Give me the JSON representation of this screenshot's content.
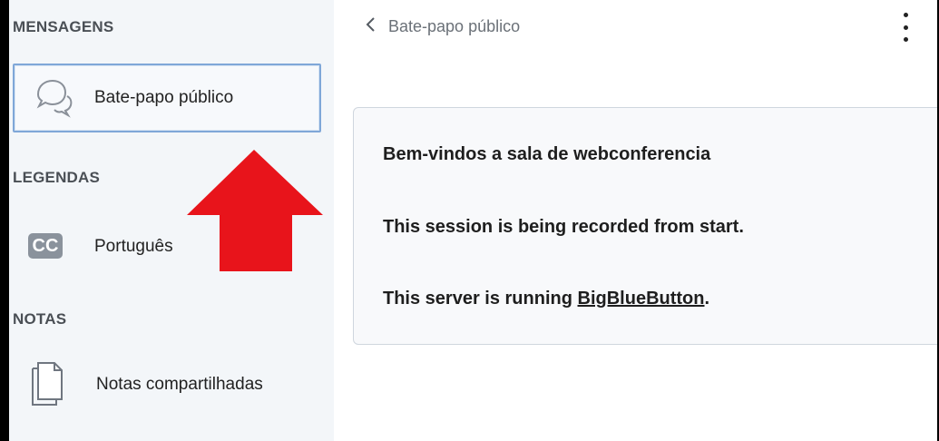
{
  "sidebar": {
    "sections": {
      "messages": "MENSAGENS",
      "captions": "LEGENDAS",
      "notes": "NOTAS"
    },
    "items": {
      "public_chat": {
        "label": "Bate-papo público",
        "icon": "chat-icon",
        "active": true
      },
      "caption_pt": {
        "label": "Português",
        "icon": "closed-captions-icon",
        "icon_text": "CC"
      },
      "shared_notes": {
        "label": "Notas compartilhadas",
        "icon": "document-icon"
      }
    }
  },
  "header": {
    "back_label": "Bate-papo público",
    "back_icon": "chevron-left-icon",
    "options_icon": "more-vertical-icon"
  },
  "welcome": {
    "line1": "Bem-vindos a sala de webconferencia",
    "line2": "This session is being recorded from start.",
    "line3_prefix": "This server is running ",
    "line3_link": "BigBlueButton",
    "line3_suffix": "."
  },
  "annotation": {
    "arrow_color": "#e8141b",
    "arrow_icon": "arrow-up-icon"
  },
  "colors": {
    "sidebar_bg": "#f3f6f9",
    "active_border": "#7fa7d8"
  }
}
